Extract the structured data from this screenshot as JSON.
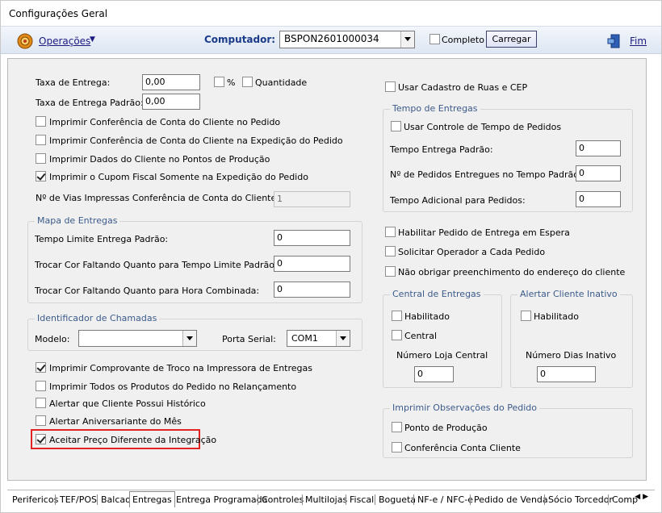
{
  "window": {
    "title": "Configurações Geral"
  },
  "toolbar": {
    "operations_label": "Operações",
    "computer_label": "Computador:",
    "computer_value": "BSPON2601000034",
    "complete_label": "Completo",
    "complete_checked": false,
    "load_button": "Carregar",
    "exit_label": "Fim"
  },
  "left": {
    "fee_label": "Taxa de Entrega:",
    "fee_value": "0,00",
    "percent_label": "%",
    "quantity_label": "Quantidade",
    "default_fee_label": "Taxa de Entrega Padrão:",
    "default_fee_value": "0,00",
    "checks_top": [
      {
        "label": "Imprimir Conferência de Conta do Cliente no Pedido",
        "checked": false
      },
      {
        "label": "Imprimir Conferência de Conta do Cliente na Expedição do Pedido",
        "checked": false
      },
      {
        "label": "Imprimir Dados do Cliente no Pontos de Produção",
        "checked": false
      },
      {
        "label": "Imprimir o Cupom Fiscal Somente na Expedição do Pedido",
        "checked": true
      }
    ],
    "copies_label": "Nº de Vias Impressas Conferência de Conta do Cliente:",
    "copies_value": "1",
    "map": {
      "title": "Mapa de Entregas",
      "time_limit_label": "Tempo Limite Entrega Padrão:",
      "time_limit_value": "0",
      "color_limit_label": "Trocar Cor Faltando Quanto para Tempo Limite Padrão:",
      "color_limit_value": "0",
      "color_combined_label": "Trocar Cor Faltando Quanto para Hora Combinada:",
      "color_combined_value": "0"
    },
    "caller": {
      "title": "Identificador de Chamadas",
      "model_label": "Modelo:",
      "model_value": "",
      "port_label": "Porta Serial:",
      "port_value": "COM1"
    },
    "checks_bottom": [
      {
        "label": "Imprimir Comprovante de Troco na Impressora de Entregas",
        "checked": true
      },
      {
        "label": "Imprimir Todos os Produtos do Pedido no Relançamento",
        "checked": false
      },
      {
        "label": "Alertar que Cliente Possui Histórico",
        "checked": false
      },
      {
        "label": "Alertar Aniversariante do Mês",
        "checked": false
      },
      {
        "label": "Aceitar Preço Diferente da Integração",
        "checked": true
      }
    ]
  },
  "right": {
    "street_register_label": "Usar Cadastro de Ruas e CEP",
    "time": {
      "title": "Tempo de Entregas",
      "use_control_label": "Usar Controle de Tempo de Pedidos",
      "default_time_label": "Tempo Entrega Padrão:",
      "default_time_value": "0",
      "orders_label": "Nº de Pedidos Entregues no Tempo Padrão:",
      "orders_value": "0",
      "additional_label": "Tempo Adicional para Pedidos:",
      "additional_value": "0"
    },
    "checks": [
      {
        "label": "Habilitar Pedido de Entrega em Espera",
        "checked": false
      },
      {
        "label": "Solicitar Operador a Cada Pedido",
        "checked": false
      },
      {
        "label": "Não obrigar preenchimento do endereço do cliente",
        "checked": false
      }
    ],
    "central": {
      "title": "Central de Entregas",
      "enabled_label": "Habilitado",
      "central_label": "Central",
      "store_number_label": "Número Loja Central",
      "store_number_value": "0"
    },
    "inactive": {
      "title": "Alertar Cliente Inativo",
      "enabled_label": "Habilitado",
      "days_label": "Número Dias Inativo",
      "days_value": "0"
    },
    "notes": {
      "title": "Imprimir Observações do Pedido",
      "production_label": "Ponto de Produção",
      "account_label": "Conferência Conta Cliente"
    }
  },
  "tabs": [
    "Perifericos",
    "TEF/POS",
    "Balcao",
    "Entregas",
    "Entrega Programada",
    "Controles",
    "Multilojas",
    "Fiscal",
    "Bogueta",
    "NF-e / NFC-e",
    "Pedido de Venda",
    "Sócio Torcedor",
    "Comp"
  ],
  "active_tab": "Entregas",
  "colors": {
    "accent": "#3b5a8a",
    "highlight": "#e32222"
  }
}
